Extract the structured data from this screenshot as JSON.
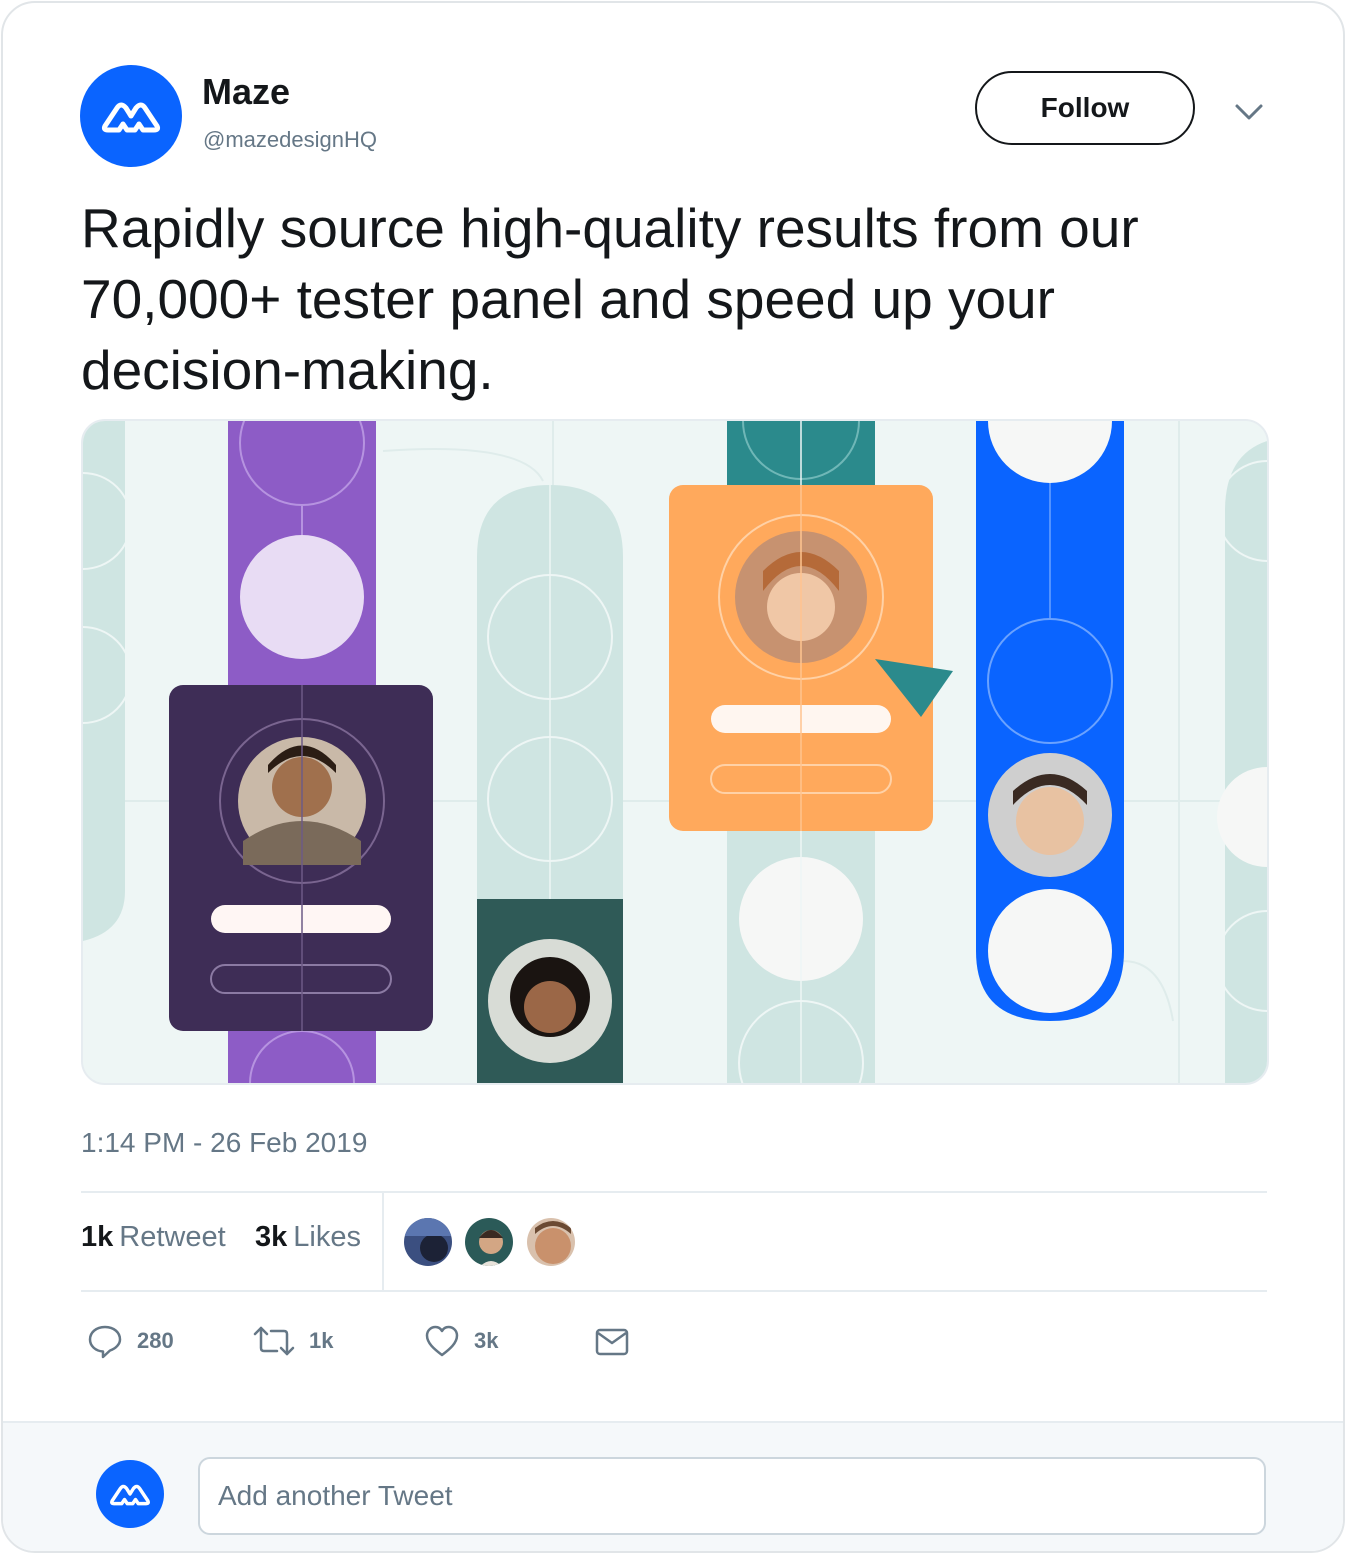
{
  "account": {
    "name": "Maze",
    "handle": "@mazedesignHQ",
    "avatar_icon": "maze-logo-icon",
    "brand_color": "#0a64ff"
  },
  "header": {
    "follow_label": "Follow",
    "menu_icon": "chevron-down-icon"
  },
  "tweet": {
    "text": "Rapidly source high-quality results from our 70,000+ tester panel and speed up your decision-making.",
    "timestamp": "1:14 PM - 26 Feb 2019"
  },
  "stats": {
    "retweets_count": "1k",
    "retweets_label": "Retweet",
    "likes_count": "3k",
    "likes_label": "Likes"
  },
  "actions": {
    "reply_count": "280",
    "retweet_count": "1k",
    "like_count": "3k"
  },
  "reply": {
    "placeholder": "Add another Tweet"
  },
  "colors": {
    "text_primary": "#14171a",
    "text_secondary": "#657786",
    "border": "#e6ecf0",
    "illustration_purple": "#8d5cc6",
    "illustration_dark_purple": "#3e2d56",
    "illustration_orange": "#ffa95c",
    "illustration_teal": "#2b8a8c",
    "illustration_mint": "#cfe5e2"
  }
}
